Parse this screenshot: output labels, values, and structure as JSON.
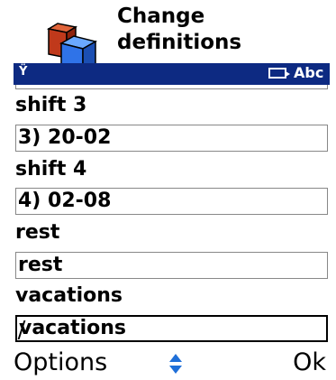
{
  "header": {
    "title_line1": "Change",
    "title_line2": "definitions",
    "app_icon": "cubes-icon"
  },
  "status_bar": {
    "signal_icon": "signal-icon",
    "signal_glyph": "Ÿ",
    "input_mode": "Abc",
    "colors": {
      "background": "#0d2a82",
      "foreground": "#ffffff"
    }
  },
  "fields": [
    {
      "label": "shift 3",
      "value": "3) 20-02"
    },
    {
      "label": "shift 4",
      "value": "4) 02-08"
    },
    {
      "label": "rest",
      "value": "rest"
    },
    {
      "label": "vacations",
      "value": "vacations"
    }
  ],
  "softkeys": {
    "left": "Options",
    "right": "Ok",
    "scroll_icon": "up-down-arrows-icon",
    "scroll_color": "#1f6fd8"
  }
}
